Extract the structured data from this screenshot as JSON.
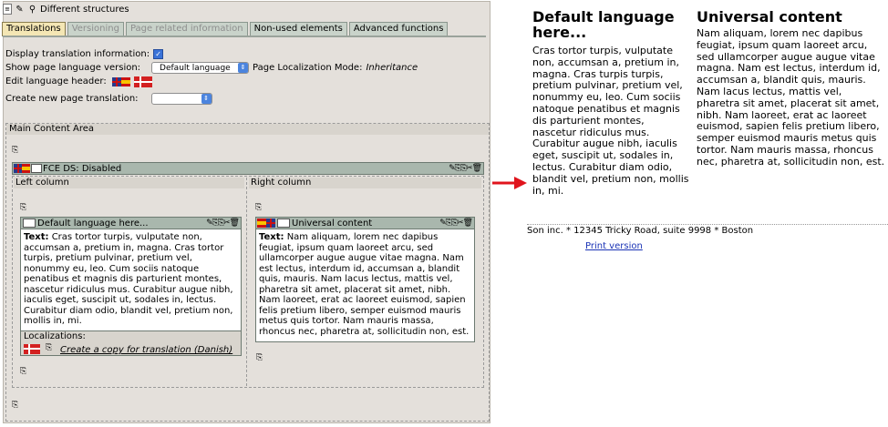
{
  "header": {
    "title": "Different structures"
  },
  "tabs": [
    {
      "label": "Translations",
      "state": "active"
    },
    {
      "label": "Versioning",
      "state": "disabled"
    },
    {
      "label": "Page related information",
      "state": "disabled"
    },
    {
      "label": "Non-used elements",
      "state": "normal"
    },
    {
      "label": "Advanced functions",
      "state": "normal"
    }
  ],
  "settings": {
    "display_translation_label": "Display translation information:",
    "display_translation_checked": true,
    "show_version_label": "Show page language version:",
    "show_version_value": "Default language",
    "localization_mode_label": "Page Localization Mode:",
    "localization_mode_value": "Inheritance",
    "edit_header_label": "Edit language header:",
    "create_translation_label": "Create new page translation:",
    "create_translation_value": ""
  },
  "main_area": {
    "label": "Main Content Area",
    "fce_title": "FCE DS: Disabled",
    "left_column_label": "Left column",
    "right_column_label": "Right column",
    "left_element": {
      "title": "Default language here...",
      "text_label": "Text:",
      "text": "Cras tortor turpis, vulputate non, accumsan a, pretium in, magna. Cras tortor turpis, pretium pulvinar, pretium vel, nonummy eu, leo. Cum sociis natoque penatibus et magnis dis parturient montes, nascetur ridiculus mus. Curabitur augue nibh, iaculis eget, suscipit ut, sodales in, lectus. Curabitur diam odio, blandit vel, pretium non, mollis in, mi.",
      "localizations_label": "Localizations:",
      "copy_link": "Create a copy for translation (Danish)"
    },
    "right_element": {
      "title": "Universal content",
      "text_label": "Text:",
      "text": "Nam aliquam, lorem nec dapibus feugiat, ipsum quam laoreet arcu, sed ullamcorper augue augue vitae magna. Nam est lectus, interdum id, accumsan a, blandit quis, mauris. Nam lacus lectus, mattis vel, pharetra sit amet, placerat sit amet, nibh. Nam laoreet, erat ac laoreet euismod, sapien felis pretium libero, semper euismod mauris metus quis tortor. Nam mauris massa, rhoncus nec, pharetra at, sollicitudin non, est."
    }
  },
  "preview": {
    "col1_heading": "Default language here...",
    "col1_text": "Cras tortor turpis, vulputate non, accumsan a, pretium in, magna. Cras turpis turpis, pretium pulvinar, pretium vel, nonummy eu, leo. Cum sociis natoque penatibus et magnis dis parturient montes, nascetur ridiculus mus. Curabitur augue nibh, iaculis eget, suscipit ut, sodales in, lectus. Curabitur diam odio, blandit vel, pretium non, mollis in, mi.",
    "col2_heading": "Universal content",
    "col2_text": "Nam aliquam, lorem nec dapibus feugiat, ipsum quam laoreet arcu, sed ullamcorper augue augue vitae magna. Nam est lectus, interdum id, accumsan a, blandit quis, mauris. Nam lacus lectus, mattis vel, pharetra sit amet, placerat sit amet, nibh. Nam laoreet, erat ac laoreet euismod, sapien felis pretium libero, semper euismod mauris metus quis tortor. Nam mauris massa, rhoncus nec, pharetra at, sollicitudin non, est.",
    "footer": "Son inc. * 12345 Tricky Road, suite 9998 * Boston",
    "print_link": "Print version"
  },
  "colors": {
    "accent_arrow": "#e0141c",
    "link": "#1a33b5",
    "tab_active": "#f4e6b4",
    "bar": "#a9b7ad"
  }
}
